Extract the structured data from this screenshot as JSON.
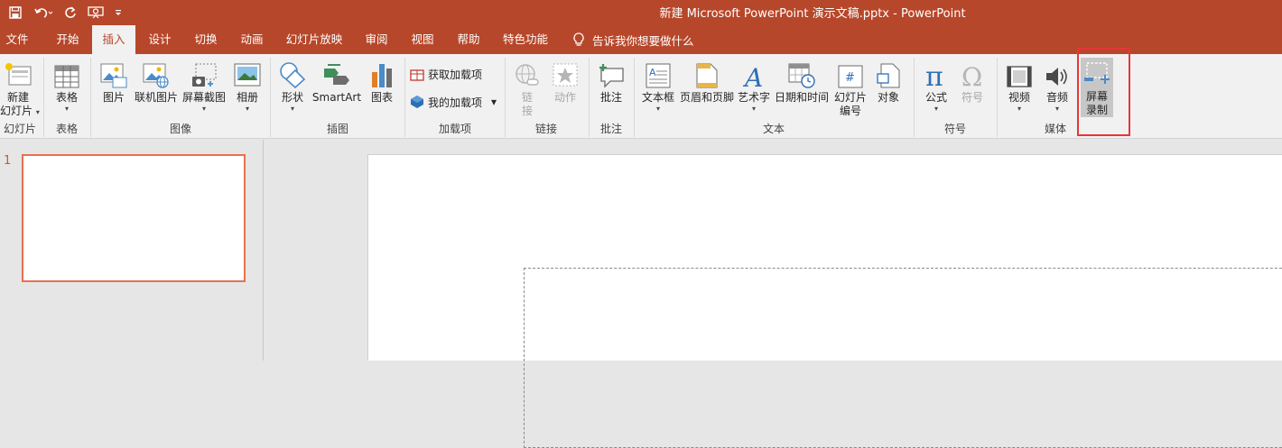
{
  "window": {
    "title": "新建 Microsoft PowerPoint 演示文稿.pptx  -  PowerPoint"
  },
  "qat": {
    "icons": [
      "save-icon",
      "undo-icon",
      "redo-icon",
      "present-from-start-icon",
      "customize-qat-icon"
    ]
  },
  "tabs": [
    "文件",
    "开始",
    "插入",
    "设计",
    "切换",
    "动画",
    "幻灯片放映",
    "审阅",
    "视图",
    "帮助",
    "特色功能"
  ],
  "active_tab": "插入",
  "tellme": {
    "label": "告诉我你想要做什么"
  },
  "ribbon": {
    "groups": {
      "slides": "幻灯片",
      "tables": "表格",
      "images": "图像",
      "illustrations": "插图",
      "addins": "加载项",
      "links": "链接",
      "comments": "批注",
      "text": "文本",
      "symbols": "符号",
      "media": "媒体"
    },
    "buttons": {
      "new_slide_1": "新建",
      "new_slide_2": "幻灯片",
      "table": "表格",
      "picture": "图片",
      "online_picture": "联机图片",
      "screenshot": "屏幕截图",
      "album": "相册",
      "shapes": "形状",
      "smartart": "SmartArt",
      "chart": "图表",
      "get_addins": "获取加载项",
      "my_addins": "我的加载项",
      "link_1": "链",
      "link_2": "接",
      "action": "动作",
      "comment": "批注",
      "textbox": "文本框",
      "header_footer": "页眉和页脚",
      "wordart": "艺术字",
      "datetime": "日期和时间",
      "slide_number_1": "幻灯片",
      "slide_number_2": "编号",
      "object": "对象",
      "equation": "公式",
      "symbol": "符号",
      "video": "视频",
      "audio": "音频",
      "screen_record_1": "屏幕",
      "screen_record_2": "录制"
    },
    "caret": "▾"
  },
  "thumbnails": {
    "slide_number": "1"
  },
  "colors": {
    "accent": "#b7472a",
    "highlight": "#e8353a",
    "thumb_border": "#e8704f"
  }
}
